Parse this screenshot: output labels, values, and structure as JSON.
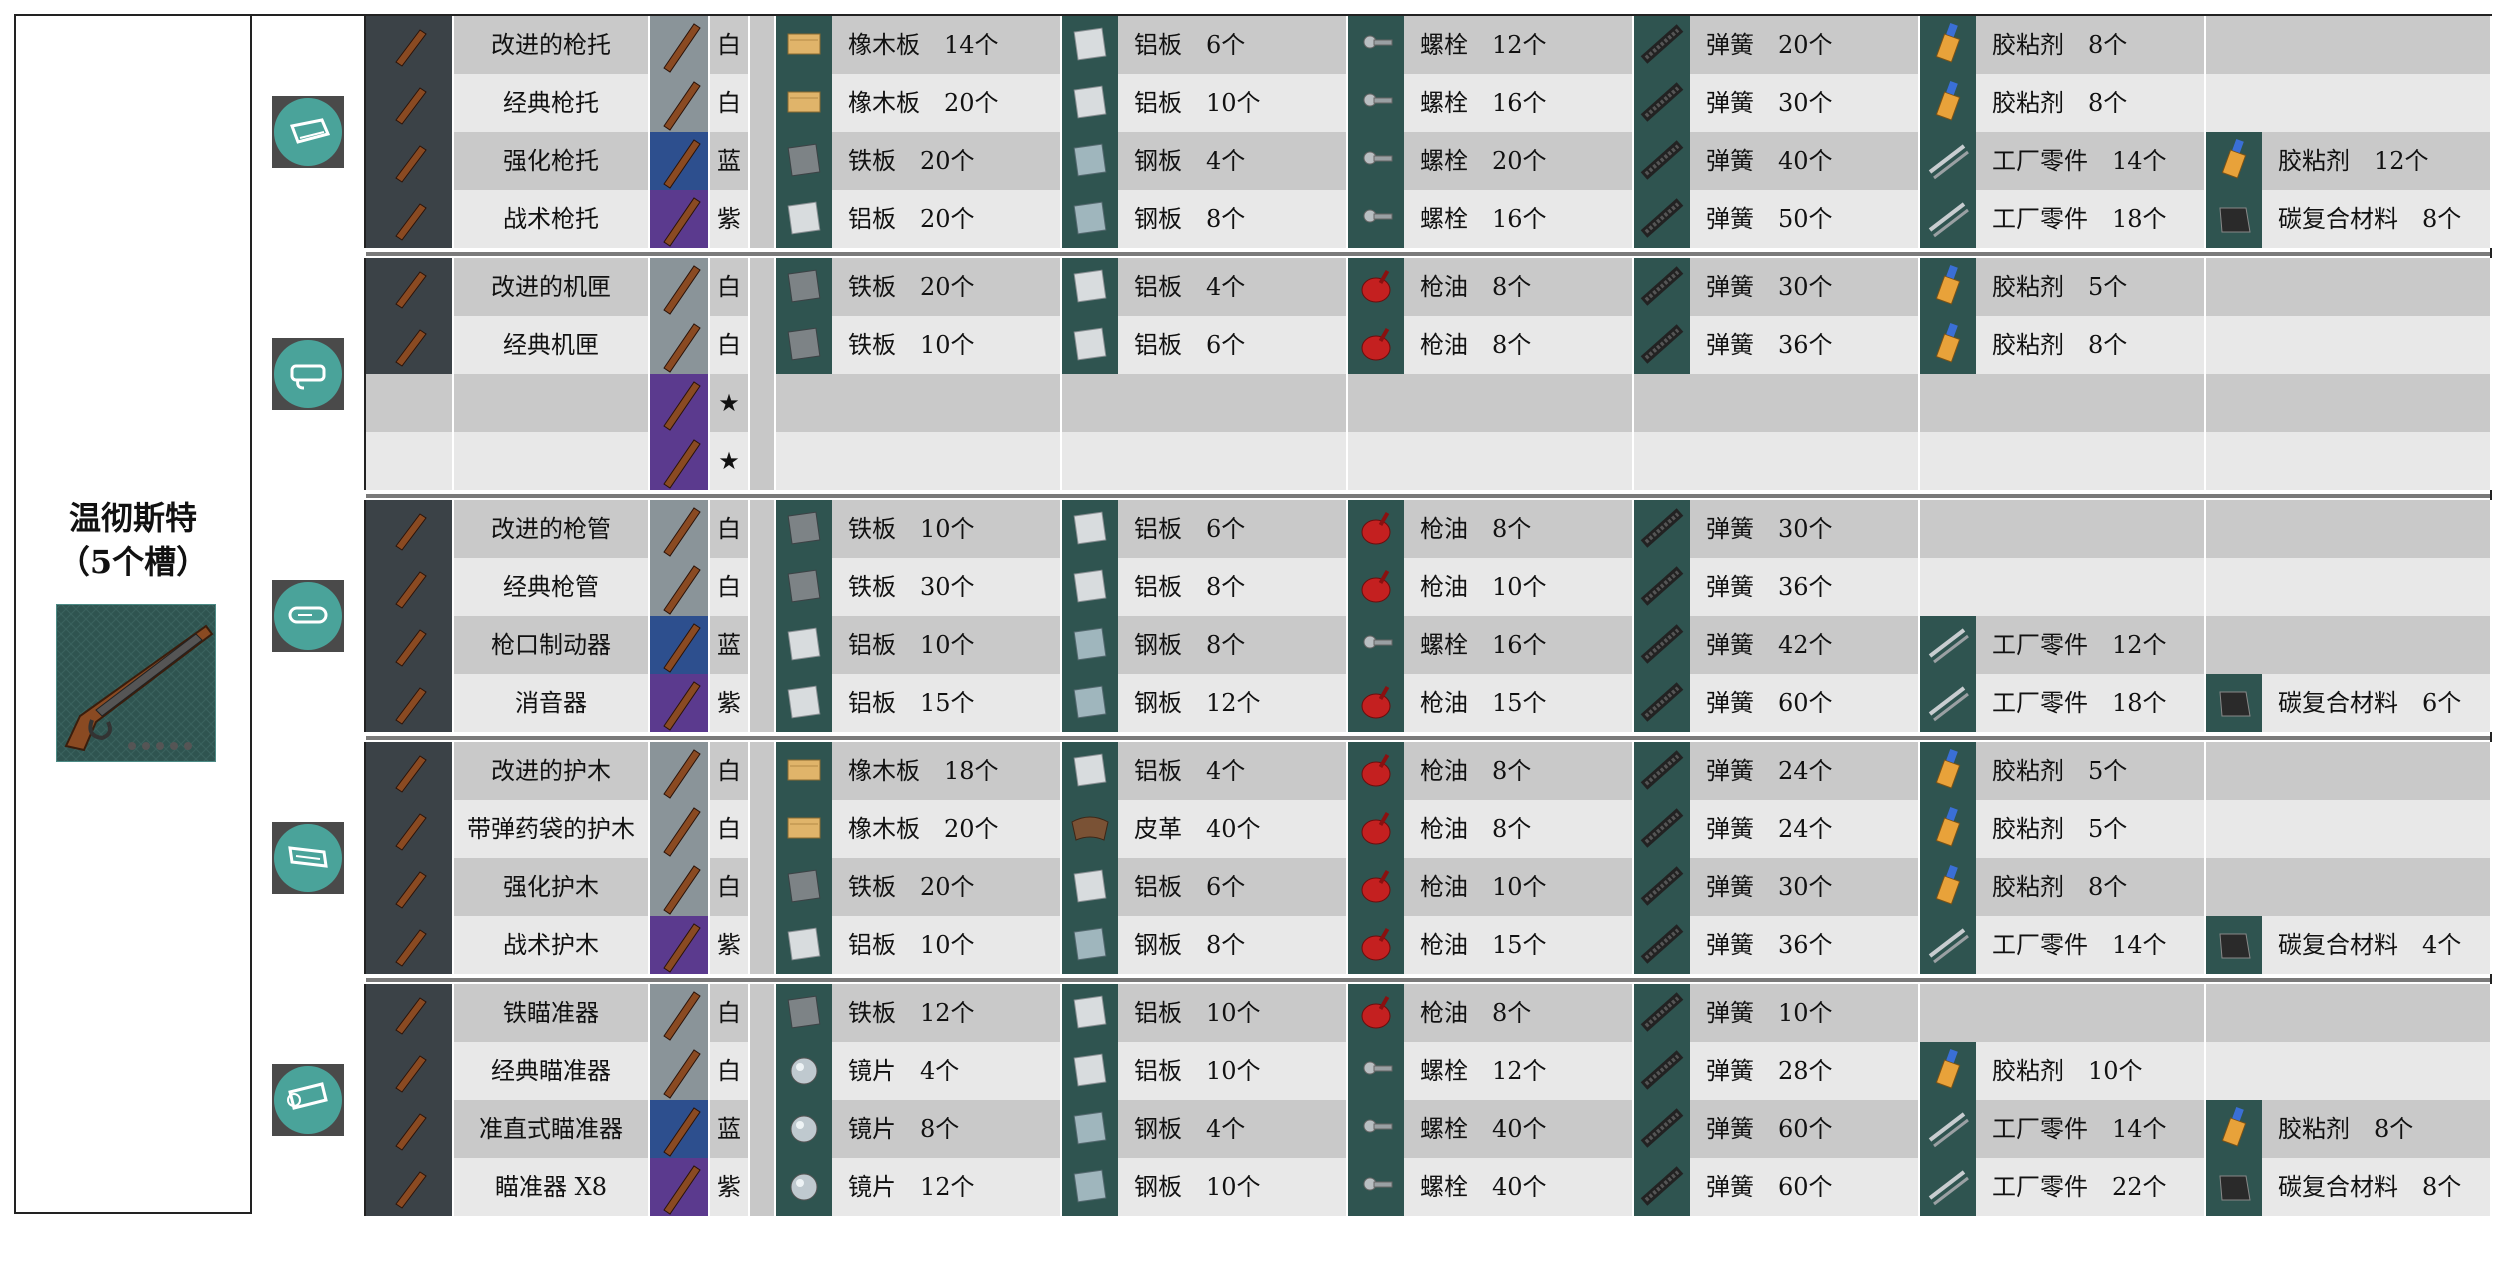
{
  "weapon": {
    "name_line1": "温彻斯特",
    "name_line2": "（5个槽）"
  },
  "colors": {
    "row_dark": "#c9c9c9",
    "row_light": "#e8e8e8",
    "tile_teal": "#2f5450",
    "white_grade": "#8a9499",
    "blue_grade": "#2d4f8e",
    "purple_grade": "#5b3a8e"
  },
  "groups": [
    {
      "icon": "stock-icon",
      "rows": [
        {
          "part": "改进的枪托",
          "grade": "白",
          "mats": [
            [
              "plank",
              "橡木板",
              "14个"
            ],
            [
              "alum",
              "铝板",
              "6个"
            ],
            [
              "bolt",
              "螺栓",
              "12个"
            ],
            [
              "spring",
              "弹簧",
              "20个"
            ],
            [
              "glue",
              "胶粘剂",
              "8个"
            ]
          ]
        },
        {
          "part": "经典枪托",
          "grade": "白",
          "mats": [
            [
              "plank",
              "橡木板",
              "20个"
            ],
            [
              "alum",
              "铝板",
              "10个"
            ],
            [
              "bolt",
              "螺栓",
              "16个"
            ],
            [
              "spring",
              "弹簧",
              "30个"
            ],
            [
              "glue",
              "胶粘剂",
              "8个"
            ]
          ]
        },
        {
          "part": "强化枪托",
          "grade": "蓝",
          "mats": [
            [
              "iron",
              "铁板",
              "20个"
            ],
            [
              "steel",
              "钢板",
              "4个"
            ],
            [
              "bolt",
              "螺栓",
              "20个"
            ],
            [
              "spring",
              "弹簧",
              "40个"
            ],
            [
              "parts",
              "工厂零件",
              "14个"
            ],
            [
              "glue",
              "胶粘剂",
              "12个"
            ]
          ]
        },
        {
          "part": "战术枪托",
          "grade": "紫",
          "mats": [
            [
              "alum",
              "铝板",
              "20个"
            ],
            [
              "steel",
              "钢板",
              "8个"
            ],
            [
              "bolt",
              "螺栓",
              "16个"
            ],
            [
              "spring",
              "弹簧",
              "50个"
            ],
            [
              "parts",
              "工厂零件",
              "18个"
            ],
            [
              "carbon",
              "碳复合材料",
              "8个"
            ]
          ]
        }
      ]
    },
    {
      "icon": "receiver-icon",
      "rows": [
        {
          "part": "改进的机匣",
          "grade": "白",
          "mats": [
            [
              "iron",
              "铁板",
              "20个"
            ],
            [
              "alum",
              "铝板",
              "4个"
            ],
            [
              "oil",
              "枪油",
              "8个"
            ],
            [
              "spring",
              "弹簧",
              "30个"
            ],
            [
              "glue",
              "胶粘剂",
              "5个"
            ]
          ]
        },
        {
          "part": "经典机匣",
          "grade": "白",
          "mats": [
            [
              "iron",
              "铁板",
              "10个"
            ],
            [
              "alum",
              "铝板",
              "6个"
            ],
            [
              "oil",
              "枪油",
              "8个"
            ],
            [
              "spring",
              "弹簧",
              "36个"
            ],
            [
              "glue",
              "胶粘剂",
              "8个"
            ]
          ]
        },
        {
          "part": "",
          "grade": "★",
          "mats": []
        },
        {
          "part": "",
          "grade": "★",
          "mats": []
        }
      ]
    },
    {
      "icon": "barrel-icon",
      "rows": [
        {
          "part": "改进的枪管",
          "grade": "白",
          "mats": [
            [
              "iron",
              "铁板",
              "10个"
            ],
            [
              "alum",
              "铝板",
              "6个"
            ],
            [
              "oil",
              "枪油",
              "8个"
            ],
            [
              "spring",
              "弹簧",
              "30个"
            ]
          ]
        },
        {
          "part": "经典枪管",
          "grade": "白",
          "mats": [
            [
              "iron",
              "铁板",
              "30个"
            ],
            [
              "alum",
              "铝板",
              "8个"
            ],
            [
              "oil",
              "枪油",
              "10个"
            ],
            [
              "spring",
              "弹簧",
              "36个"
            ]
          ]
        },
        {
          "part": "枪口制动器",
          "grade": "蓝",
          "mats": [
            [
              "alum",
              "铝板",
              "10个"
            ],
            [
              "steel",
              "钢板",
              "8个"
            ],
            [
              "bolt",
              "螺栓",
              "16个"
            ],
            [
              "spring",
              "弹簧",
              "42个"
            ],
            [
              "parts",
              "工厂零件",
              "12个"
            ]
          ]
        },
        {
          "part": "消音器",
          "grade": "紫",
          "mats": [
            [
              "alum",
              "铝板",
              "15个"
            ],
            [
              "steel",
              "钢板",
              "12个"
            ],
            [
              "oil",
              "枪油",
              "15个"
            ],
            [
              "spring",
              "弹簧",
              "60个"
            ],
            [
              "parts",
              "工厂零件",
              "18个"
            ],
            [
              "carbon",
              "碳复合材料",
              "6个"
            ]
          ]
        }
      ]
    },
    {
      "icon": "handguard-icon",
      "rows": [
        {
          "part": "改进的护木",
          "grade": "白",
          "mats": [
            [
              "plank",
              "橡木板",
              "18个"
            ],
            [
              "alum",
              "铝板",
              "4个"
            ],
            [
              "oil",
              "枪油",
              "8个"
            ],
            [
              "spring",
              "弹簧",
              "24个"
            ],
            [
              "glue",
              "胶粘剂",
              "5个"
            ]
          ]
        },
        {
          "part": "带弹药袋的护木",
          "grade": "白",
          "mats": [
            [
              "plank",
              "橡木板",
              "20个"
            ],
            [
              "leather",
              "皮革",
              "40个"
            ],
            [
              "oil",
              "枪油",
              "8个"
            ],
            [
              "spring",
              "弹簧",
              "24个"
            ],
            [
              "glue",
              "胶粘剂",
              "5个"
            ]
          ]
        },
        {
          "part": "强化护木",
          "grade": "白",
          "mats": [
            [
              "iron",
              "铁板",
              "20个"
            ],
            [
              "alum",
              "铝板",
              "6个"
            ],
            [
              "oil",
              "枪油",
              "10个"
            ],
            [
              "spring",
              "弹簧",
              "30个"
            ],
            [
              "glue",
              "胶粘剂",
              "8个"
            ]
          ]
        },
        {
          "part": "战术护木",
          "grade": "紫",
          "mats": [
            [
              "alum",
              "铝板",
              "10个"
            ],
            [
              "steel",
              "钢板",
              "8个"
            ],
            [
              "oil",
              "枪油",
              "15个"
            ],
            [
              "spring",
              "弹簧",
              "36个"
            ],
            [
              "parts",
              "工厂零件",
              "14个"
            ],
            [
              "carbon",
              "碳复合材料",
              "4个"
            ]
          ]
        }
      ]
    },
    {
      "icon": "scope-icon",
      "rows": [
        {
          "part": "铁瞄准器",
          "grade": "白",
          "mats": [
            [
              "iron",
              "铁板",
              "12个"
            ],
            [
              "alum",
              "铝板",
              "10个"
            ],
            [
              "oil",
              "枪油",
              "8个"
            ],
            [
              "spring",
              "弹簧",
              "10个"
            ]
          ]
        },
        {
          "part": "经典瞄准器",
          "grade": "白",
          "mats": [
            [
              "lens",
              "镜片",
              "4个"
            ],
            [
              "alum",
              "铝板",
              "10个"
            ],
            [
              "bolt",
              "螺栓",
              "12个"
            ],
            [
              "spring",
              "弹簧",
              "28个"
            ],
            [
              "glue",
              "胶粘剂",
              "10个"
            ]
          ]
        },
        {
          "part": "准直式瞄准器",
          "grade": "蓝",
          "mats": [
            [
              "lens",
              "镜片",
              "8个"
            ],
            [
              "steel",
              "钢板",
              "4个"
            ],
            [
              "bolt",
              "螺栓",
              "40个"
            ],
            [
              "spring",
              "弹簧",
              "60个"
            ],
            [
              "parts",
              "工厂零件",
              "14个"
            ],
            [
              "glue",
              "胶粘剂",
              "8个"
            ]
          ]
        },
        {
          "part": "瞄准器 X8",
          "grade": "紫",
          "mats": [
            [
              "lens",
              "镜片",
              "12个"
            ],
            [
              "steel",
              "钢板",
              "10个"
            ],
            [
              "bolt",
              "螺栓",
              "40个"
            ],
            [
              "spring",
              "弹簧",
              "60个"
            ],
            [
              "parts",
              "工厂零件",
              "22个"
            ],
            [
              "carbon",
              "碳复合材料",
              "8个"
            ]
          ]
        }
      ]
    }
  ]
}
